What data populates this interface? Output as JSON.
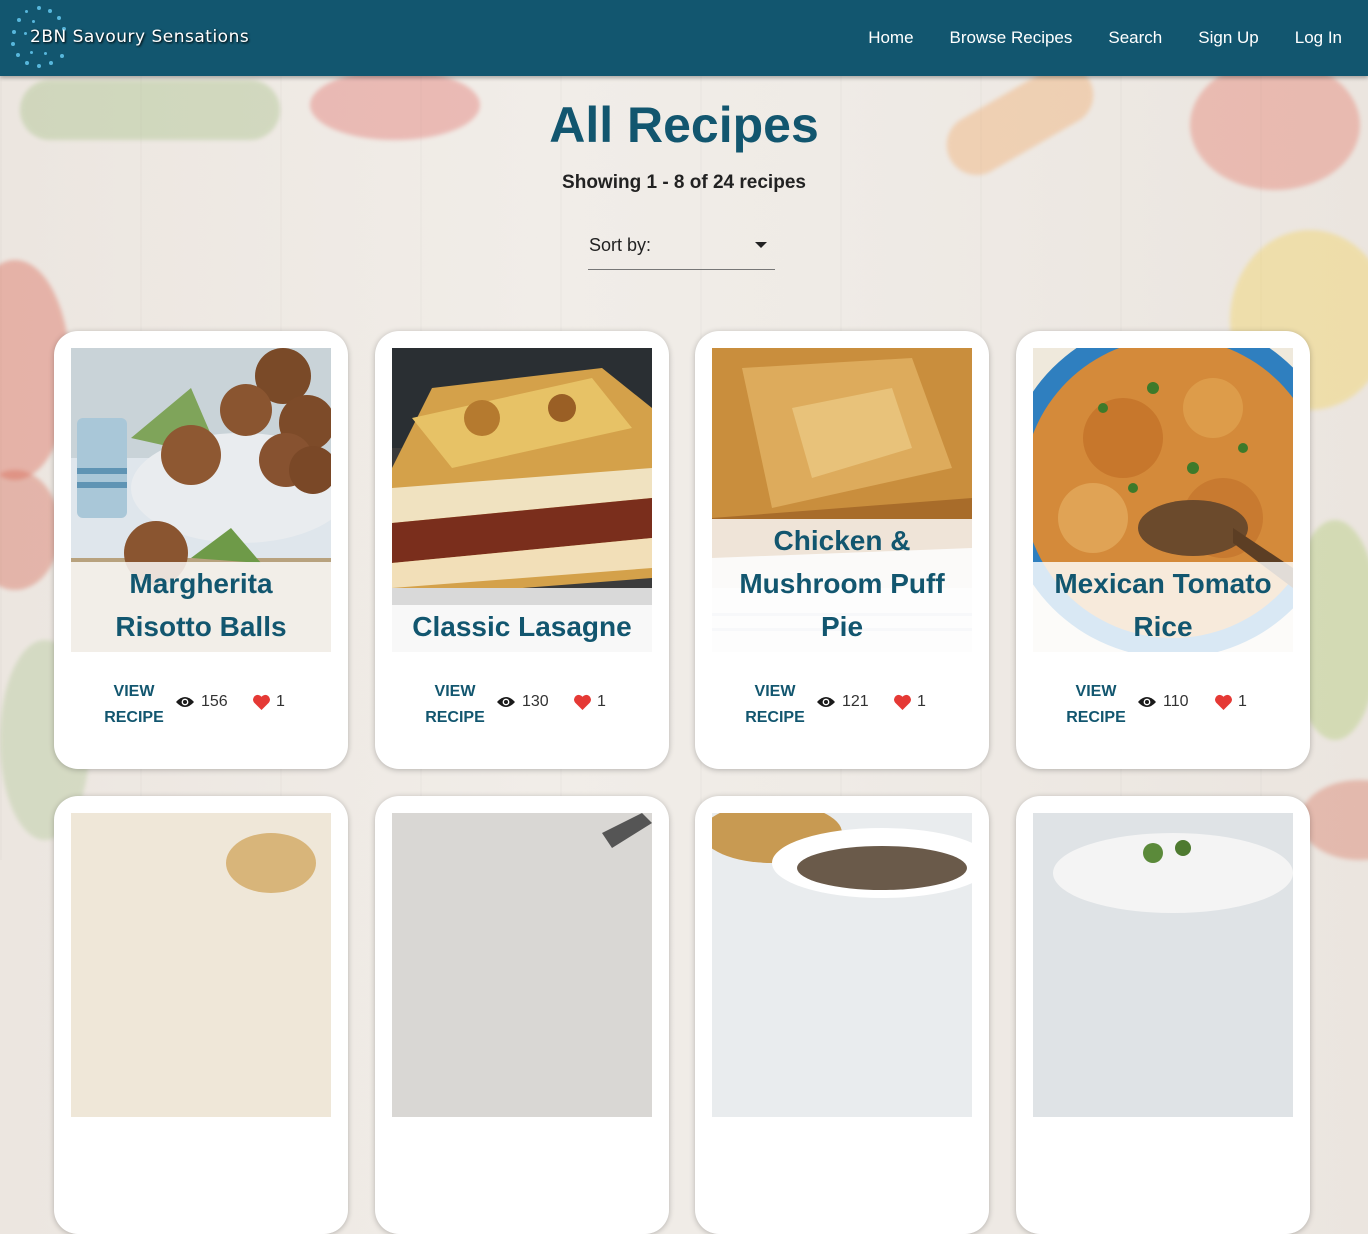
{
  "header": {
    "brand": "2BN Savoury Sensations",
    "nav": [
      "Home",
      "Browse Recipes",
      "Search",
      "Sign Up",
      "Log In"
    ]
  },
  "page": {
    "title": "All Recipes",
    "showing": "Showing 1 - 8 of 24 recipes",
    "sort_label": "Sort by:"
  },
  "recipes": [
    {
      "name": "Margherita Risotto Balls",
      "action": "VIEW RECIPE",
      "views": "156",
      "likes": "1"
    },
    {
      "name": "Classic Lasagne",
      "action": "VIEW RECIPE",
      "views": "130",
      "likes": "1"
    },
    {
      "name": "Chicken & Mushroom Puff Pie",
      "action": "VIEW RECIPE",
      "views": "121",
      "likes": "1"
    },
    {
      "name": "Mexican Tomato Rice",
      "action": "VIEW RECIPE",
      "views": "110",
      "likes": "1"
    }
  ],
  "colors": {
    "primary": "#12566f",
    "heart": "#e53935",
    "logo_dots": "#57b7dc"
  }
}
